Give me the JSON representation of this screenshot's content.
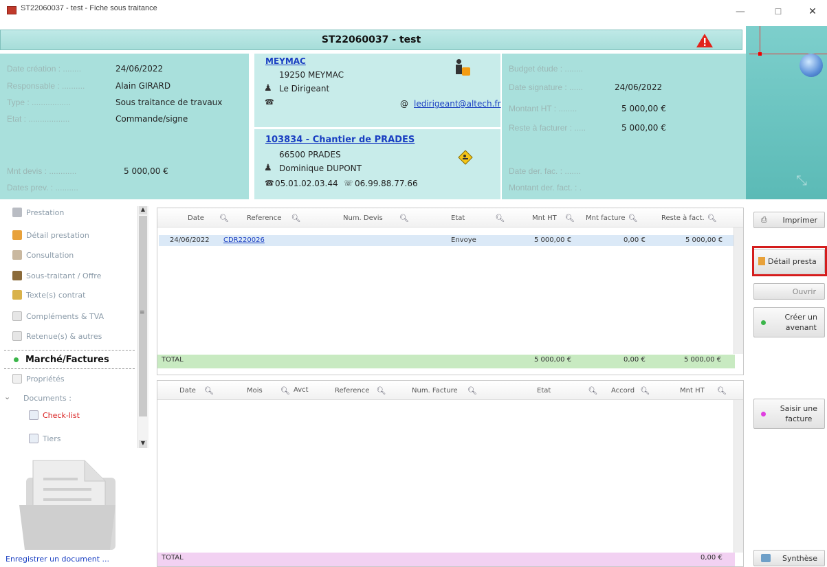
{
  "window": {
    "title": "ST22060037 - test - Fiche sous traitance",
    "minimize": "—",
    "maximize": "☐",
    "close": "✕"
  },
  "header": {
    "title": "ST22060037 - test"
  },
  "info_left": {
    "date_creation_label": "Date création : ........",
    "date_creation": "24/06/2022",
    "responsable_label": "Responsable : ..........",
    "responsable": "Alain GIRARD",
    "type_label": "Type : .................",
    "type": "Sous traitance de travaux",
    "etat_label": "Etat : ..................",
    "etat": "Commande/signe",
    "mnt_devis_label": "Mnt devis : ............",
    "mnt_devis": "5 000,00 €",
    "dates_prev_label": "Dates prev. : .........."
  },
  "info_mid": {
    "company": "MEYMAC",
    "company_city": "19250 MEYMAC",
    "contact": "Le Dirigeant",
    "email": "ledirigeant@altech.fr",
    "email_prefix": "@",
    "chantier": "103834 - Chantier de PRADES",
    "chantier_city": "66500 PRADES",
    "chantier_contact": "Dominique DUPONT",
    "phone": "05.01.02.03.44",
    "mobile": "06.99.88.77.66"
  },
  "info_right": {
    "budget_label": "Budget étude : ........",
    "date_sig_label": "Date signature : ......",
    "date_sig": "24/06/2022",
    "montant_ht_label": "Montant HT : ........",
    "montant_ht": "5 000,00 €",
    "reste_label": "Reste à facturer : .....",
    "reste": "5 000,00 €",
    "date_der_label": "Date der. fac. : .......",
    "montant_der_label": "Montant der. fact. : ."
  },
  "sidebar": {
    "items": [
      "Prestation",
      "Détail prestation",
      "Consultation",
      "Sous-traitant / Offre",
      "Texte(s) contrat",
      "Compléments & TVA",
      "Retenue(s) & autres",
      "Marché/Factures",
      "Propriétés",
      "Documents :",
      "Check-list",
      "Tiers"
    ],
    "save_link": "Enregistrer un document ..."
  },
  "grid_top": {
    "columns": [
      "Date",
      "Reference",
      "Num. Devis",
      "Etat",
      "Mnt HT",
      "Mnt facture",
      "Reste à fact."
    ],
    "row": {
      "date": "24/06/2022",
      "reference": "CDR220026",
      "etat": "Envoye",
      "mnt_ht": "5 000,00 €",
      "mnt_facture": "0,00 €",
      "reste": "5 000,00 €"
    },
    "total_label": "TOTAL",
    "total_mnt_ht": "5 000,00 €",
    "total_facture": "0,00 €",
    "total_reste": "5 000,00 €"
  },
  "grid_bottom": {
    "columns": [
      "Date",
      "Mois",
      "Avct",
      "Reference",
      "Num. Facture",
      "Etat",
      "Accord",
      "Mnt HT"
    ],
    "total_label": "TOTAL",
    "total_mnt_ht": "0,00 €"
  },
  "buttons": {
    "imprimer": "Imprimer",
    "detail": "Détail presta",
    "ouvrir": "Ouvrir",
    "avenant1": "Créer un",
    "avenant2": "avenant",
    "facture1": "Saisir une",
    "facture2": "facture",
    "synthese": "Synthèse"
  },
  "colors": {
    "header": "#a6ddd9",
    "panel": "#a9e0dc",
    "total_top": "#c8eac1",
    "total_bottom": "#f2d1f2",
    "highlight": "#d41c1c"
  }
}
